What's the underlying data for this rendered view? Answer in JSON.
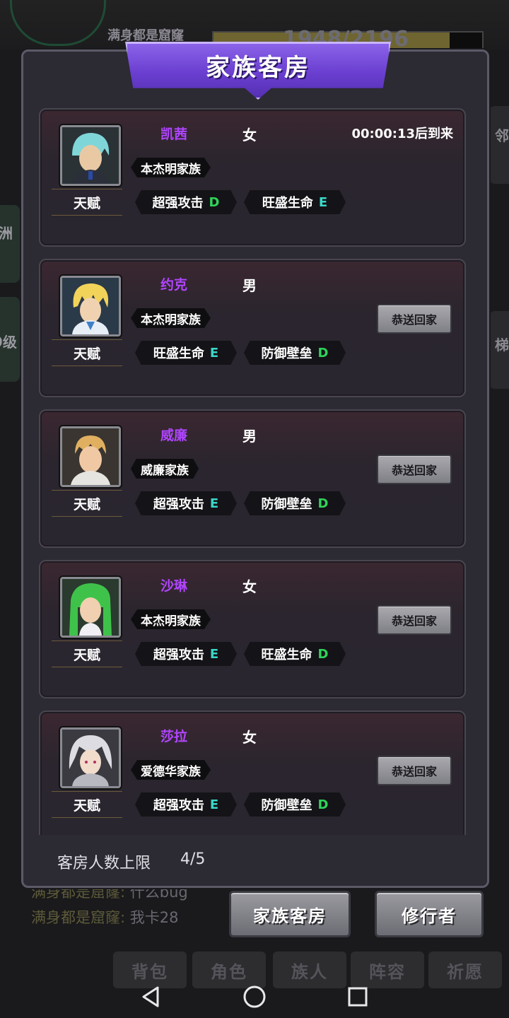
{
  "background": {
    "player_name": "满身都是窟窿",
    "exp_text": "1948/2196",
    "left_side_labels": [
      "洲",
      "9级"
    ],
    "right_side_labels": [
      "邻",
      "梯"
    ],
    "chat": [
      {
        "sender": "满身都是窟窿:",
        "message": "什么bug"
      },
      {
        "sender": "满身都是窟窿:",
        "message": "我卡28"
      }
    ],
    "tabs": [
      "背包",
      "角色",
      "族人",
      "阵容",
      "祈愿"
    ]
  },
  "modal": {
    "title": "家族客房",
    "talent_label": "天赋",
    "send_home_label": "恭送回家",
    "guests": [
      {
        "name": "凯茜",
        "gender": "女",
        "family": "本杰明家族",
        "timer": "00:00:13后到来",
        "avatar": "avatar-cyan-hair-icon",
        "talents": [
          {
            "name": "超强攻击",
            "grade": "D"
          },
          {
            "name": "旺盛生命",
            "grade": "E"
          }
        ]
      },
      {
        "name": "约克",
        "gender": "男",
        "family": "本杰明家族",
        "avatar": "avatar-blonde-hair-icon",
        "talents": [
          {
            "name": "旺盛生命",
            "grade": "E"
          },
          {
            "name": "防御壁垒",
            "grade": "D"
          }
        ]
      },
      {
        "name": "威廉",
        "gender": "男",
        "family": "威廉家族",
        "avatar": "avatar-short-blonde-icon",
        "talents": [
          {
            "name": "超强攻击",
            "grade": "E"
          },
          {
            "name": "防御壁垒",
            "grade": "D"
          }
        ]
      },
      {
        "name": "沙琳",
        "gender": "女",
        "family": "本杰明家族",
        "avatar": "avatar-green-hair-icon",
        "talents": [
          {
            "name": "超强攻击",
            "grade": "E"
          },
          {
            "name": "旺盛生命",
            "grade": "D"
          }
        ]
      },
      {
        "name": "莎拉",
        "gender": "女",
        "family": "爱德华家族",
        "avatar": "avatar-silver-hair-icon",
        "talents": [
          {
            "name": "超强攻击",
            "grade": "E"
          },
          {
            "name": "防御壁垒",
            "grade": "D"
          }
        ]
      }
    ],
    "capacity_label": "客房人数上限",
    "capacity_value": "4/5"
  },
  "buttons": {
    "guest_room": "家族客房",
    "cultivator": "修行者"
  },
  "colors": {
    "name": "#b045ff",
    "grade_D": "#2fd35a",
    "grade_E": "#3ad8c8",
    "title_banner": "#6a3ed0"
  },
  "navbar": [
    "back-icon",
    "home-icon",
    "recents-icon"
  ]
}
